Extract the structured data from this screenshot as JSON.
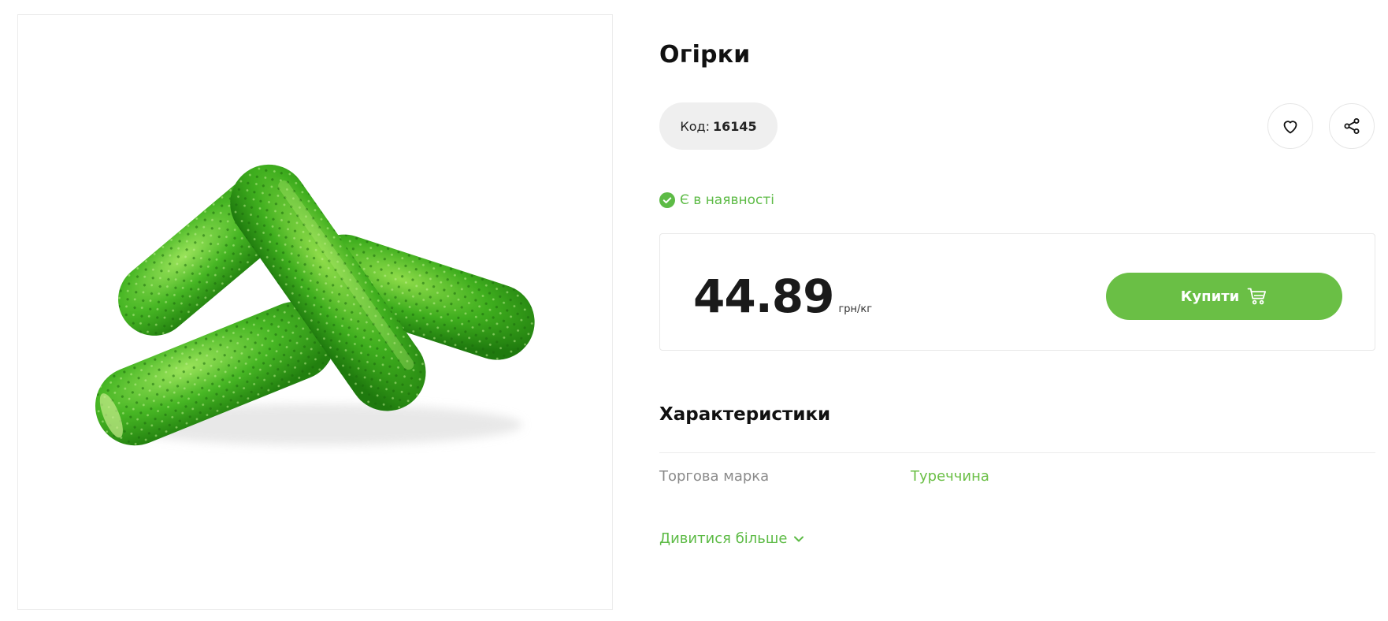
{
  "product": {
    "title": "Огірки",
    "image_alt": "cucumbers"
  },
  "code": {
    "label": "Код:",
    "value": "16145"
  },
  "actions": {
    "favorite_icon": "heart-icon",
    "share_icon": "share-icon"
  },
  "stock": {
    "label": "Є в наявності",
    "icon": "check-circle-icon"
  },
  "price": {
    "amount": "44.89",
    "unit": "грн/кг"
  },
  "buy": {
    "label": "Купити",
    "icon": "cart-icon"
  },
  "specs": {
    "title": "Характеристики",
    "rows": [
      {
        "key": "Торгова марка",
        "value": "Туреччина"
      }
    ]
  },
  "more": {
    "label": "Дивитися більше",
    "icon": "chevron-down-icon"
  },
  "colors": {
    "accent": "#6abf45",
    "pill_bg": "#efefef",
    "text": "#111111",
    "muted": "#8a8a8a"
  }
}
